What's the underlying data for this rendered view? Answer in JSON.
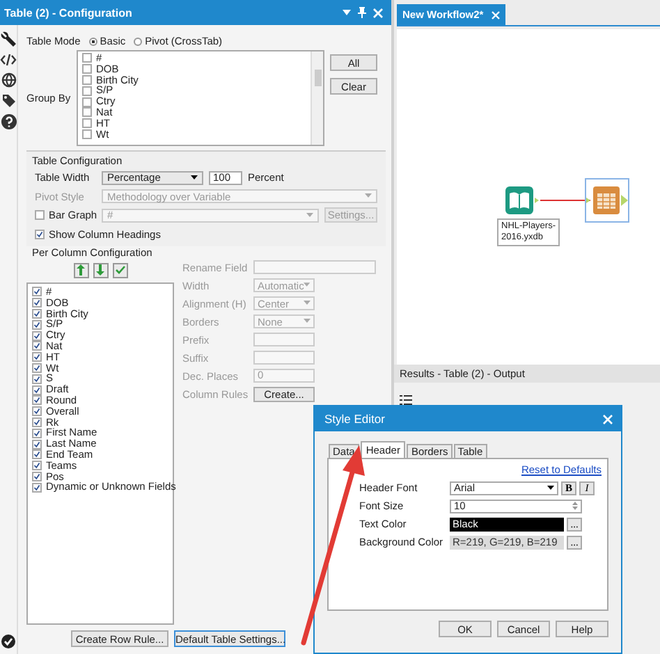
{
  "configuration": {
    "title": "Table (2) - Configuration",
    "table_mode": {
      "label": "Table Mode",
      "options": [
        {
          "label": "Basic",
          "selected": true
        },
        {
          "label": "Pivot (CrossTab)",
          "selected": false
        }
      ]
    },
    "group_by": {
      "label": "Group By",
      "items": [
        {
          "label": "#",
          "checked": false
        },
        {
          "label": "DOB",
          "checked": false
        },
        {
          "label": "Birth City",
          "checked": false
        },
        {
          "label": "S/P",
          "checked": false
        },
        {
          "label": "Ctry",
          "checked": false
        },
        {
          "label": "Nat",
          "checked": false
        },
        {
          "label": "HT",
          "checked": false
        },
        {
          "label": "Wt",
          "checked": false
        }
      ],
      "buttons": [
        "All",
        "Clear"
      ]
    },
    "table_configuration": {
      "title": "Table Configuration",
      "table_width": {
        "label": "Table Width",
        "value": "Percentage",
        "number": "100",
        "unit": "Percent"
      },
      "pivot_style": {
        "label": "Pivot Style",
        "value": "Methodology over Variable"
      },
      "bar_graph": {
        "label": "Bar Graph",
        "checked": false,
        "value": "#",
        "button": "Settings..."
      },
      "show_column_headings": {
        "label": "Show Column Headings",
        "checked": true
      }
    },
    "per_column": {
      "title": "Per Column Configuration",
      "fields": [
        {
          "label": "#",
          "checked": true
        },
        {
          "label": "DOB",
          "checked": true
        },
        {
          "label": "Birth City",
          "checked": true
        },
        {
          "label": "S/P",
          "checked": true
        },
        {
          "label": "Ctry",
          "checked": true
        },
        {
          "label": "Nat",
          "checked": true
        },
        {
          "label": "HT",
          "checked": true
        },
        {
          "label": "Wt",
          "checked": true
        },
        {
          "label": "S",
          "checked": true
        },
        {
          "label": "Draft",
          "checked": true
        },
        {
          "label": "Round",
          "checked": true
        },
        {
          "label": "Overall",
          "checked": true
        },
        {
          "label": "Rk",
          "checked": true
        },
        {
          "label": "First Name",
          "checked": true
        },
        {
          "label": "Last Name",
          "checked": true
        },
        {
          "label": "End Team",
          "checked": true
        },
        {
          "label": "Teams",
          "checked": true
        },
        {
          "label": "Pos",
          "checked": true
        },
        {
          "label": "Dynamic or Unknown Fields",
          "checked": true
        }
      ],
      "properties": [
        {
          "kind": "text",
          "label": "Rename Field"
        },
        {
          "kind": "select",
          "label": "Width",
          "value": "Automatic"
        },
        {
          "kind": "select",
          "label": "Alignment (H)",
          "value": "Center"
        },
        {
          "kind": "select",
          "label": "Borders",
          "value": "None"
        },
        {
          "kind": "text",
          "label": "Prefix"
        },
        {
          "kind": "text",
          "label": "Suffix"
        },
        {
          "kind": "spin",
          "label": "Dec. Places",
          "value": "0"
        },
        {
          "kind": "button",
          "label": "Column Rules",
          "value": "Create..."
        }
      ]
    },
    "buttons": [
      "Create Row Rule...",
      "Default Table Settings..."
    ]
  },
  "workflow": {
    "tab": "New Workflow2*",
    "input_label": [
      "NHL-Players-",
      "2016.yxdb"
    ]
  },
  "results": {
    "title": "Results - Table (2) - Output"
  },
  "style_editor": {
    "title": "Style Editor",
    "tabs": [
      {
        "label": "Data",
        "selected": false
      },
      {
        "label": "Header",
        "selected": true
      },
      {
        "label": "Borders",
        "selected": false
      },
      {
        "label": "Table",
        "selected": false
      }
    ],
    "link": "Reset to Defaults",
    "rows": [
      {
        "kind": "font",
        "label": "Header Font",
        "value": "Arial",
        "styles": [
          "B",
          "I"
        ]
      },
      {
        "kind": "spin",
        "label": "Font Size",
        "value": "10"
      },
      {
        "kind": "color",
        "label": "Text Color",
        "value": "Black",
        "color": "#000000",
        "browse": "..."
      },
      {
        "kind": "color",
        "label": "Background Color",
        "value": "R=219, G=219, B=219",
        "color": "#dbdbdb",
        "browse": "..."
      }
    ],
    "buttons": [
      "OK",
      "Cancel",
      "Help"
    ]
  }
}
